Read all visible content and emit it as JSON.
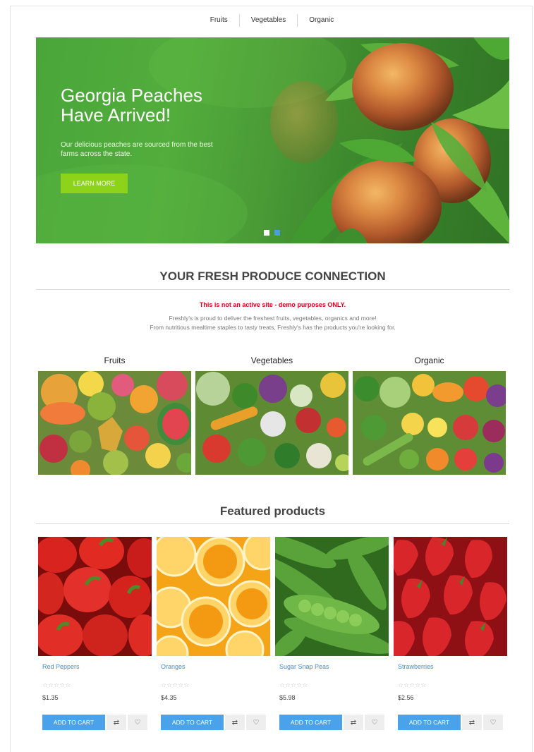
{
  "nav": {
    "items": [
      {
        "label": "Fruits"
      },
      {
        "label": "Vegetables"
      },
      {
        "label": "Organic"
      }
    ]
  },
  "hero": {
    "title": "Georgia Peaches Have Arrived!",
    "subtitle": "Our delicious peaches are sourced from the best farms across the state.",
    "button_label": "LEARN MORE",
    "slide_count": 2,
    "active_slide": 2,
    "button_color": "#8cd319"
  },
  "intro": {
    "heading": "YOUR FRESH PRODUCE CONNECTION",
    "demo_note": "This is not an active site - demo purposes ONLY.",
    "line1": "Freshly's is proud to deliver the freshest fruits, vegetables, organics and more!",
    "line2": "From nutritious mealtime staples to tasty treats, Freshly's has the products you're looking for."
  },
  "categories": [
    {
      "label": "Fruits"
    },
    {
      "label": "Vegetables"
    },
    {
      "label": "Organic"
    }
  ],
  "featured": {
    "heading": "Featured products",
    "products": [
      {
        "name": "Red Peppers",
        "price": "$1.35",
        "rating": 0,
        "cart_label": "ADD TO CART"
      },
      {
        "name": "Oranges",
        "price": "$4.35",
        "rating": 0,
        "cart_label": "ADD TO CART"
      },
      {
        "name": "Sugar Snap Peas",
        "price": "$5.98",
        "rating": 0,
        "cart_label": "ADD TO CART"
      },
      {
        "name": "Strawberries",
        "price": "$2.56",
        "rating": 0,
        "cart_label": "ADD TO CART"
      }
    ]
  },
  "icons": {
    "compare": "compare-icon",
    "wishlist": "heart-icon",
    "star": "star-outline-icon"
  },
  "colors": {
    "accent_blue": "#4aa3ea",
    "link_blue": "#3e8ed8",
    "warning_red": "#e0001b",
    "hero_green": "#4aa63a"
  }
}
